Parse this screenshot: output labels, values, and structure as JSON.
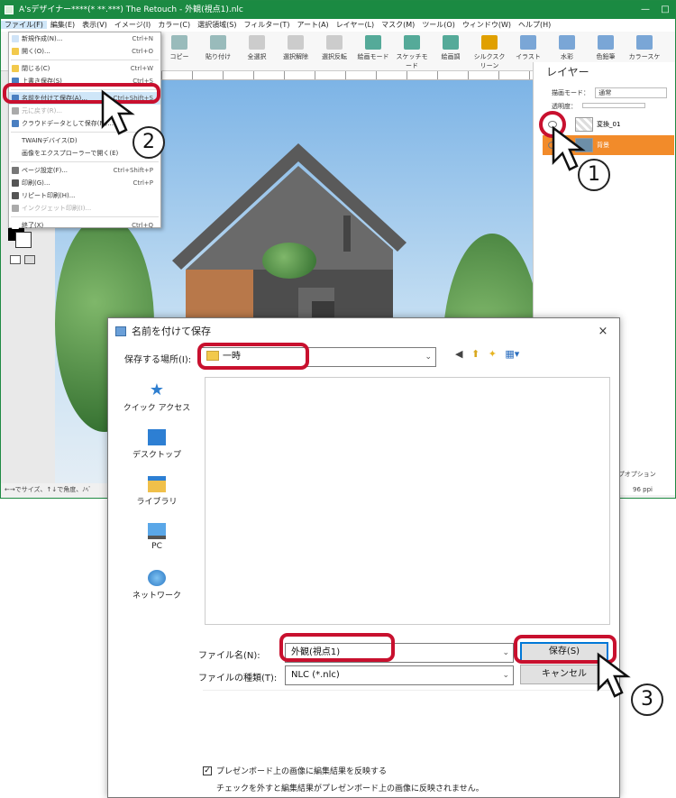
{
  "app": {
    "title": "A'sデザイナー****(* **.***) The Retouch - 外観(視点1).nlc",
    "menu": [
      "ファイル(F)",
      "編集(E)",
      "表示(V)",
      "イメージ(I)",
      "カラー(C)",
      "選択領域(S)",
      "フィルター(T)",
      "アート(A)",
      "レイヤー(L)",
      "マスク(M)",
      "ツール(O)",
      "ウィンドウ(W)",
      "ヘルプ(H)"
    ],
    "toolbar": [
      "コピー",
      "貼り付け",
      "全選択",
      "選択解除",
      "選択反転",
      "絵画モード",
      "スケッチモード",
      "絵画調",
      "シルクスクリーン",
      "イラスト",
      "水彩",
      "色鉛筆",
      "カラースケッチ"
    ],
    "status_text": "←→でサイズ、↑↓で角度、ﾉﾍﾞ"
  },
  "file_menu": {
    "items": [
      {
        "label": "新規作成(N)...",
        "shortcut": "Ctrl+N"
      },
      {
        "label": "開く(O)...",
        "shortcut": "Ctrl+O"
      },
      {
        "label": "閉じる(C)",
        "shortcut": "Ctrl+W"
      },
      {
        "label": "上書き保存(S)",
        "shortcut": "Ctrl+S"
      },
      {
        "label": "名前を付けて保存(A)...",
        "shortcut": "Ctrl+Shift+S"
      },
      {
        "label": "元に戻す(R)...",
        "shortcut": ""
      },
      {
        "label": "クラウドデータとして保存(M)...",
        "shortcut": ""
      },
      {
        "label": "TWAINデバイス(D)",
        "shortcut": ""
      },
      {
        "label": "画像をエクスプローラーで開く(E)",
        "shortcut": ""
      },
      {
        "label": "ページ設定(F)...",
        "shortcut": "Ctrl+Shift+P"
      },
      {
        "label": "印刷(G)...",
        "shortcut": "Ctrl+P"
      },
      {
        "label": "リピート印刷(H)...",
        "shortcut": ""
      },
      {
        "label": "インクジェット印刷(I)...",
        "shortcut": ""
      },
      {
        "label": "終了(X)",
        "shortcut": "Ctrl+Q"
      }
    ]
  },
  "layer_panel": {
    "title": "レイヤー",
    "blend_label": "描画モード：",
    "blend_value": "通常",
    "opacity_label": "透明度：",
    "layers": [
      {
        "name": "変換_01"
      },
      {
        "name": "背景"
      }
    ],
    "bottom_label": "ランプオプション",
    "ppi": "96 ppi"
  },
  "dialog": {
    "title": "名前を付けて保存",
    "close": "×",
    "save_in_label": "保存する場所(I):",
    "save_in_value": "一時",
    "places": [
      "クイック アクセス",
      "デスクトップ",
      "ライブラリ",
      "PC",
      "ネットワーク"
    ],
    "filename_label": "ファイル名(N):",
    "filename_value": "外観(視点1)",
    "filetype_label": "ファイルの種類(T):",
    "filetype_value": "NLC (*.nlc)",
    "save_button": "保存(S)",
    "cancel_button": "キャンセル",
    "checkbox_label": "プレゼンボード上の画像に編集結果を反映する",
    "checkbox_checked": true,
    "note": "チェックを外すと編集結果がプレゼンボード上の画像に反映されません。"
  },
  "annotations": {
    "step1": "1",
    "step2": "2",
    "step3": "3",
    "highlight_color": "#c8102e"
  },
  "colors": {
    "app_green": "#1b8a42",
    "selected_layer": "#f28b2a",
    "primary_blue": "#0078d7"
  }
}
